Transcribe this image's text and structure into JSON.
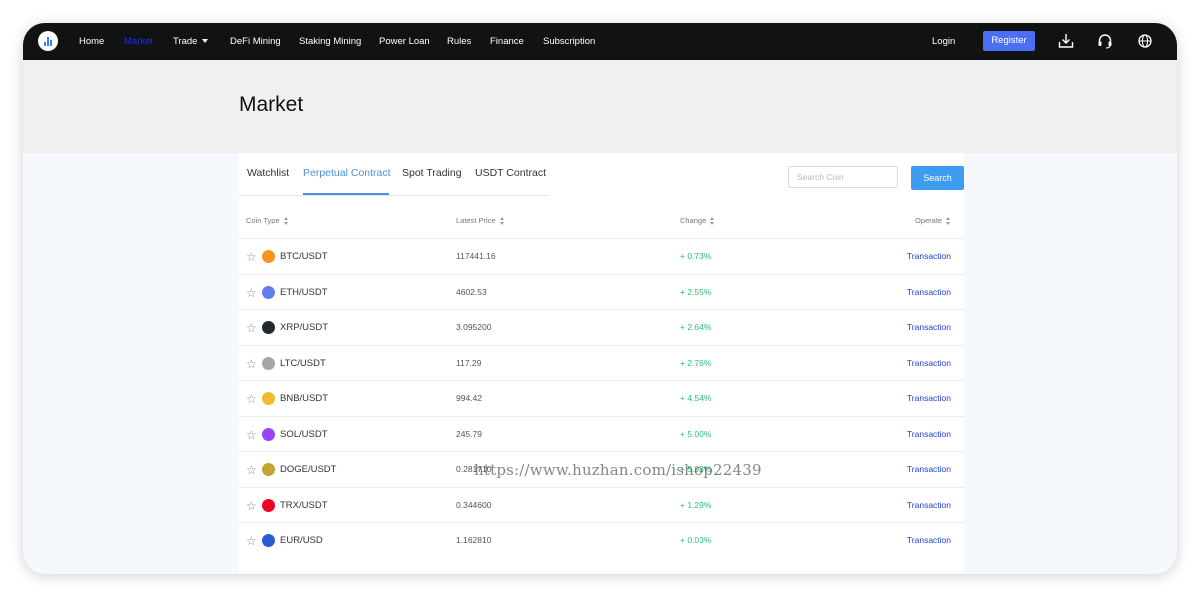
{
  "nav": {
    "items": [
      {
        "label": "Home"
      },
      {
        "label": "Market"
      },
      {
        "label": "Trade"
      },
      {
        "label": "DeFi Mining"
      },
      {
        "label": "Staking Mining"
      },
      {
        "label": "Power Loan"
      },
      {
        "label": "Rules"
      },
      {
        "label": "Finance"
      },
      {
        "label": "Subscription"
      }
    ],
    "active_index": 1,
    "login_label": "Login",
    "register_label": "Register",
    "icons": [
      "download-icon",
      "headset-icon",
      "globe-icon"
    ]
  },
  "page": {
    "title": "Market"
  },
  "tabs": [
    {
      "label": "Watchlist"
    },
    {
      "label": "Perpetual Contract"
    },
    {
      "label": "Spot Trading"
    },
    {
      "label": "USDT Contract"
    }
  ],
  "active_tab": 1,
  "search": {
    "placeholder": "Search Coin",
    "button_label": "Search"
  },
  "table": {
    "headers": [
      "Coin Type",
      "Latest Price",
      "Change",
      "Operate"
    ],
    "rows": [
      {
        "pair": "BTC/USDT",
        "price": "117441.16",
        "change": "+ 0.73%",
        "operate": "Transaction",
        "icon": "bitcoin-icon",
        "color": "#f7931a"
      },
      {
        "pair": "ETH/USDT",
        "price": "4602.53",
        "change": "+ 2.55%",
        "operate": "Transaction",
        "icon": "ethereum-icon",
        "color": "#627eea"
      },
      {
        "pair": "XRP/USDT",
        "price": "3.095200",
        "change": "+ 2.64%",
        "operate": "Transaction",
        "icon": "xrp-icon",
        "color": "#23292f"
      },
      {
        "pair": "LTC/USDT",
        "price": "117.29",
        "change": "+ 2.76%",
        "operate": "Transaction",
        "icon": "litecoin-icon",
        "color": "#a6a6a6"
      },
      {
        "pair": "BNB/USDT",
        "price": "994.42",
        "change": "+ 4.54%",
        "operate": "Transaction",
        "icon": "bnb-icon",
        "color": "#f3ba2f"
      },
      {
        "pair": "SOL/USDT",
        "price": "245.79",
        "change": "+ 5.00%",
        "operate": "Transaction",
        "icon": "solana-icon",
        "color": "#9945ff"
      },
      {
        "pair": "DOGE/USDT",
        "price": "0.281710",
        "change": "+ 5.93%",
        "operate": "Transaction",
        "icon": "dogecoin-icon",
        "color": "#c2a633"
      },
      {
        "pair": "TRX/USDT",
        "price": "0.344600",
        "change": "+ 1.29%",
        "operate": "Transaction",
        "icon": "tron-icon",
        "color": "#ef0027"
      },
      {
        "pair": "EUR/USD",
        "price": "1.162810",
        "change": "+ 0.03%",
        "operate": "Transaction",
        "icon": "euro-icon",
        "color": "#2a5bd7"
      }
    ]
  },
  "colors": {
    "positive": "#2fbf71",
    "link": "#1c3fdc",
    "accent": "#4a90e2",
    "register_bg": "#4c6ef5",
    "search_bg": "#3d9bf0",
    "nav_bg": "#111214",
    "nav_active": "#1a2cff"
  },
  "watermark": "https://www.huzhan.com/ishop22439"
}
